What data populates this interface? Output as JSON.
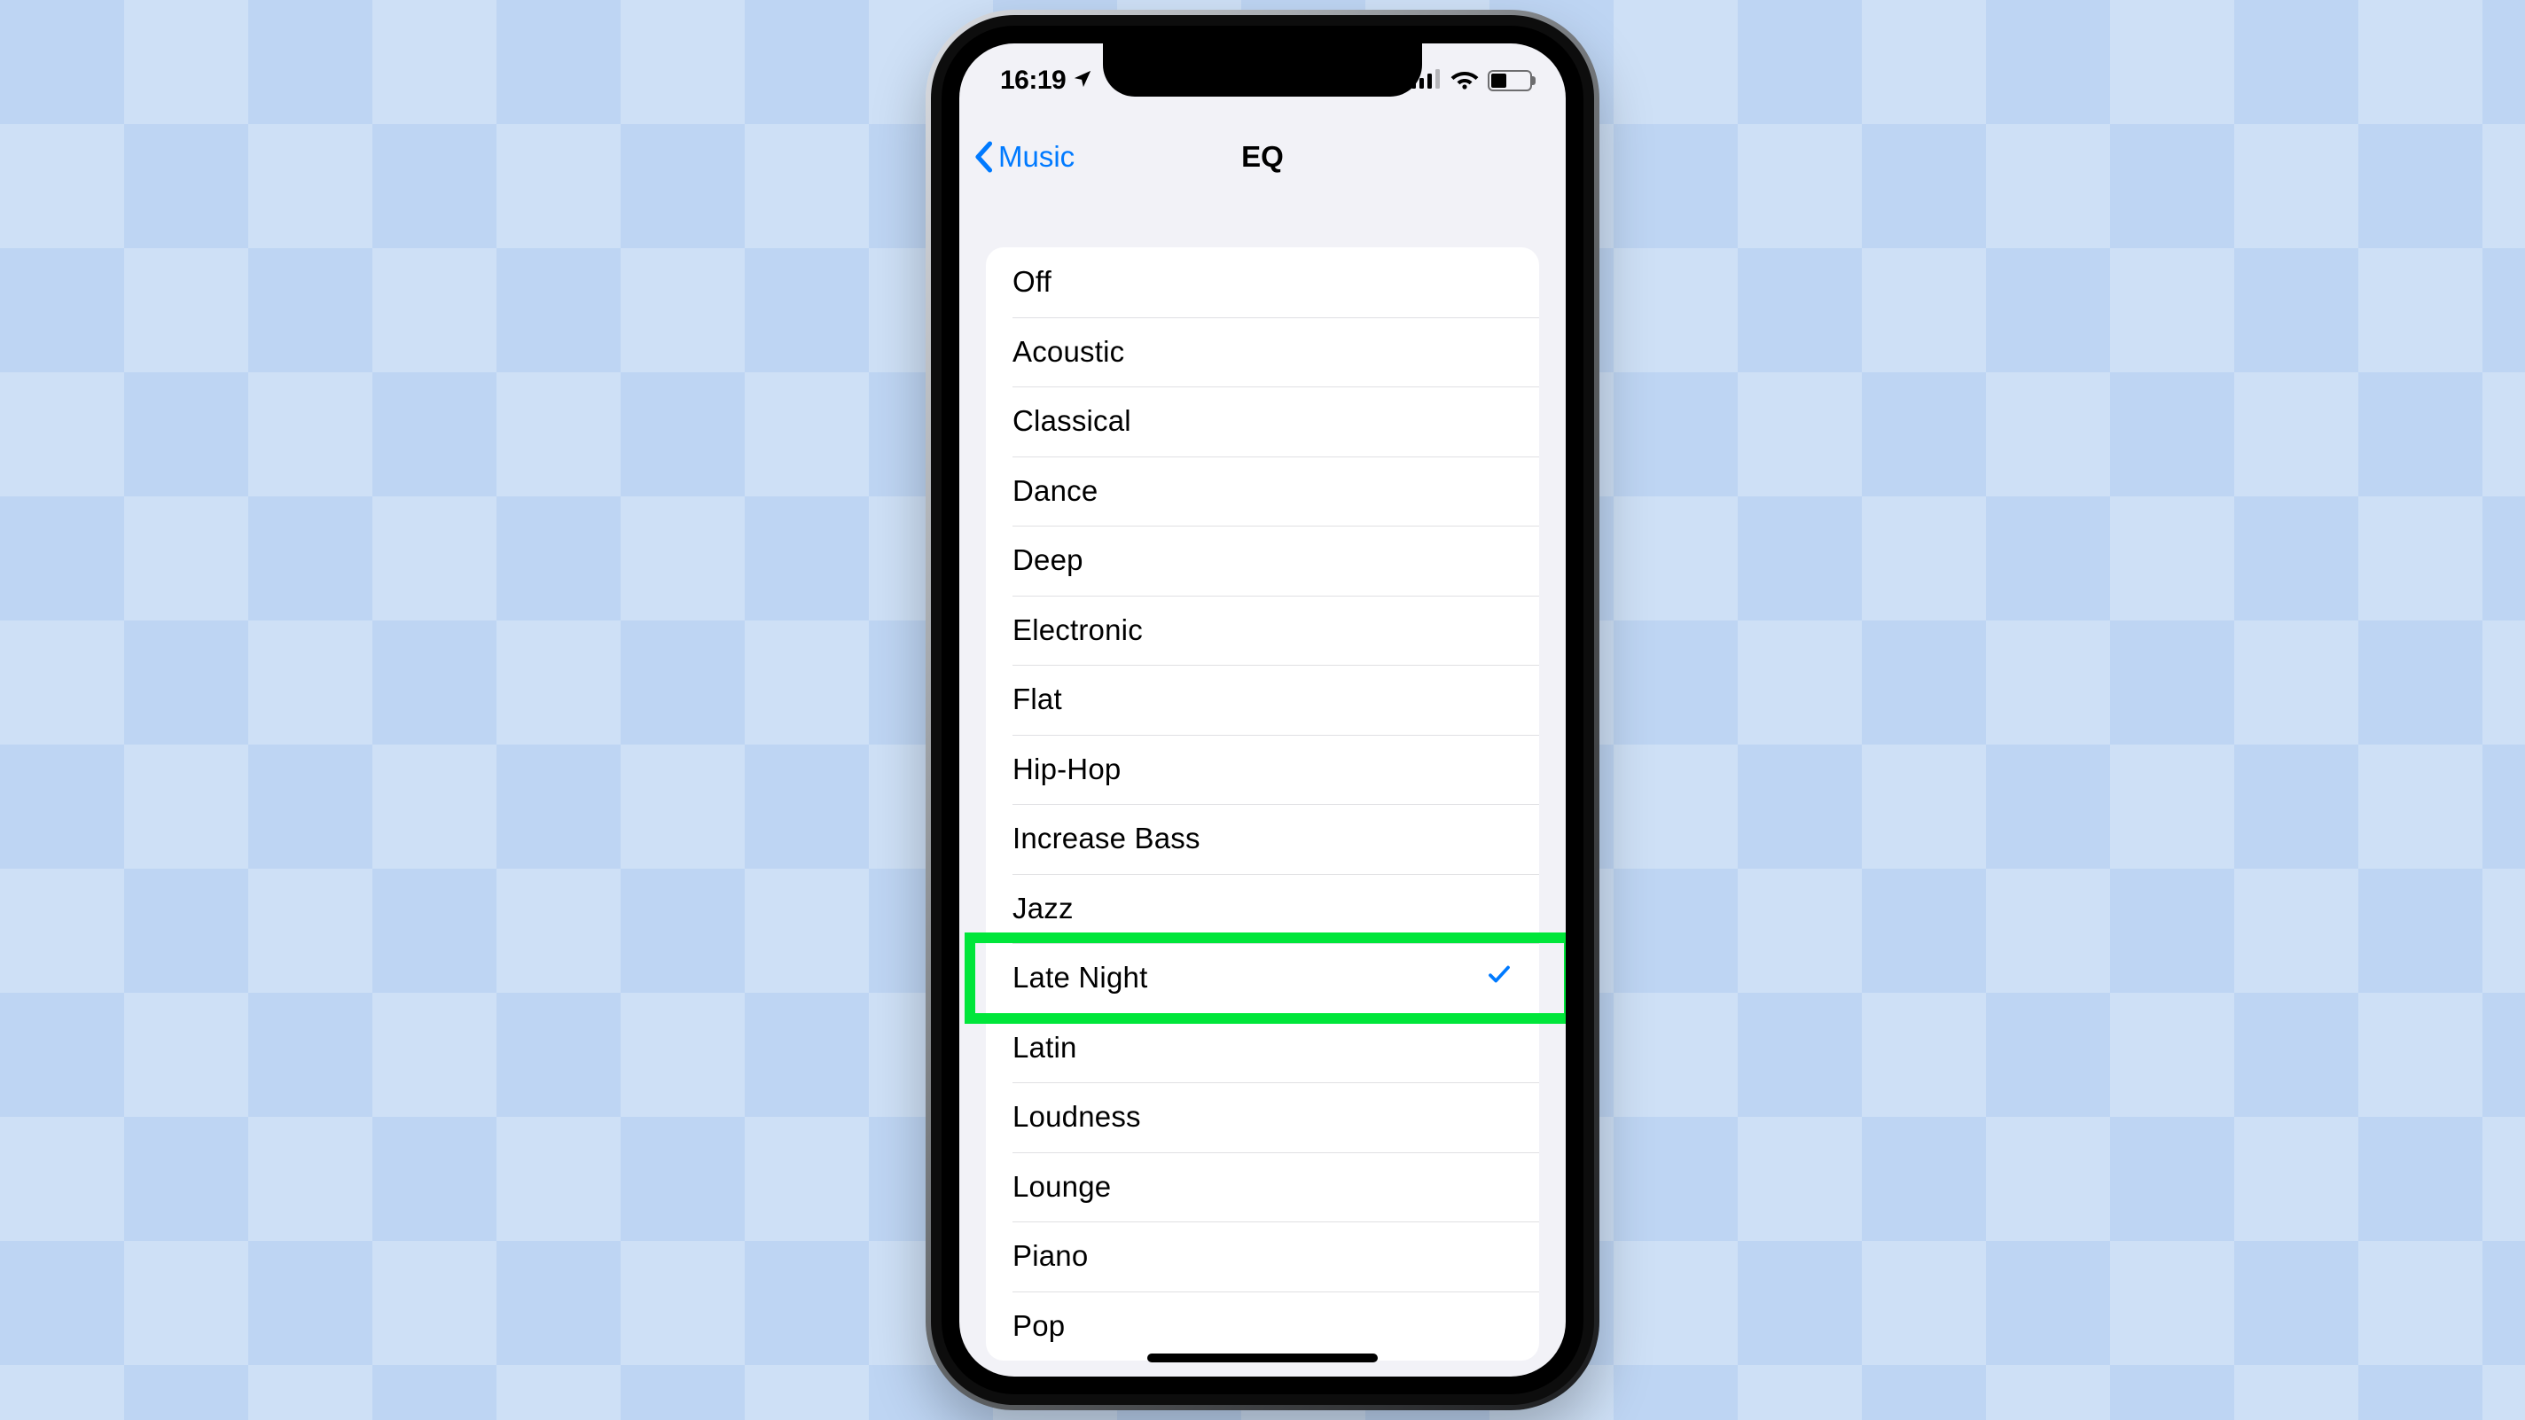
{
  "status": {
    "time": "16:19"
  },
  "nav": {
    "back_label": "Music",
    "title": "EQ"
  },
  "eq": {
    "items": [
      {
        "label": "Off",
        "selected": false,
        "highlighted": false
      },
      {
        "label": "Acoustic",
        "selected": false,
        "highlighted": false
      },
      {
        "label": "Classical",
        "selected": false,
        "highlighted": false
      },
      {
        "label": "Dance",
        "selected": false,
        "highlighted": false
      },
      {
        "label": "Deep",
        "selected": false,
        "highlighted": false
      },
      {
        "label": "Electronic",
        "selected": false,
        "highlighted": false
      },
      {
        "label": "Flat",
        "selected": false,
        "highlighted": false
      },
      {
        "label": "Hip-Hop",
        "selected": false,
        "highlighted": false
      },
      {
        "label": "Increase Bass",
        "selected": false,
        "highlighted": false
      },
      {
        "label": "Jazz",
        "selected": false,
        "highlighted": false
      },
      {
        "label": "Late Night",
        "selected": true,
        "highlighted": true
      },
      {
        "label": "Latin",
        "selected": false,
        "highlighted": false
      },
      {
        "label": "Loudness",
        "selected": false,
        "highlighted": false
      },
      {
        "label": "Lounge",
        "selected": false,
        "highlighted": false
      },
      {
        "label": "Piano",
        "selected": false,
        "highlighted": false
      },
      {
        "label": "Pop",
        "selected": false,
        "highlighted": false
      }
    ]
  },
  "colors": {
    "ios_blue": "#007aff",
    "highlight_green": "#00e63a",
    "bg_light_blue": "#bed5f3"
  }
}
